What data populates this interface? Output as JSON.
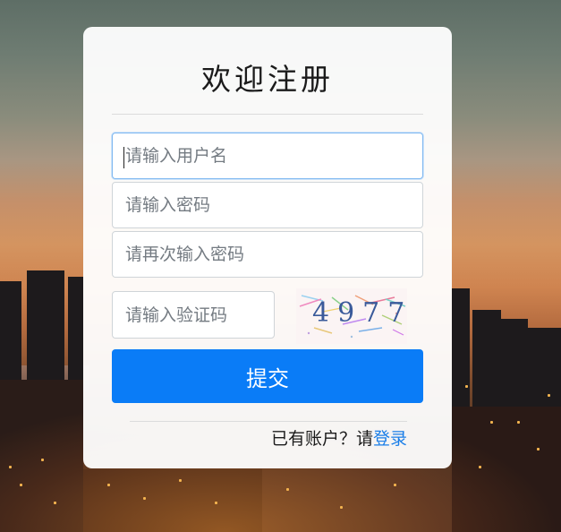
{
  "form": {
    "title": "欢迎注册",
    "username_placeholder": "请输入用户名",
    "password_placeholder": "请输入密码",
    "confirm_password_placeholder": "请再次输入密码",
    "captcha_placeholder": "请输入验证码",
    "captcha_code": "4977",
    "submit_label": "提交",
    "have_account_text": "已有账户？请",
    "login_link_label": "登录"
  },
  "colors": {
    "primary": "#0a7cf7",
    "link": "#1a7ee8",
    "focus_border": "#7fb8f0"
  }
}
